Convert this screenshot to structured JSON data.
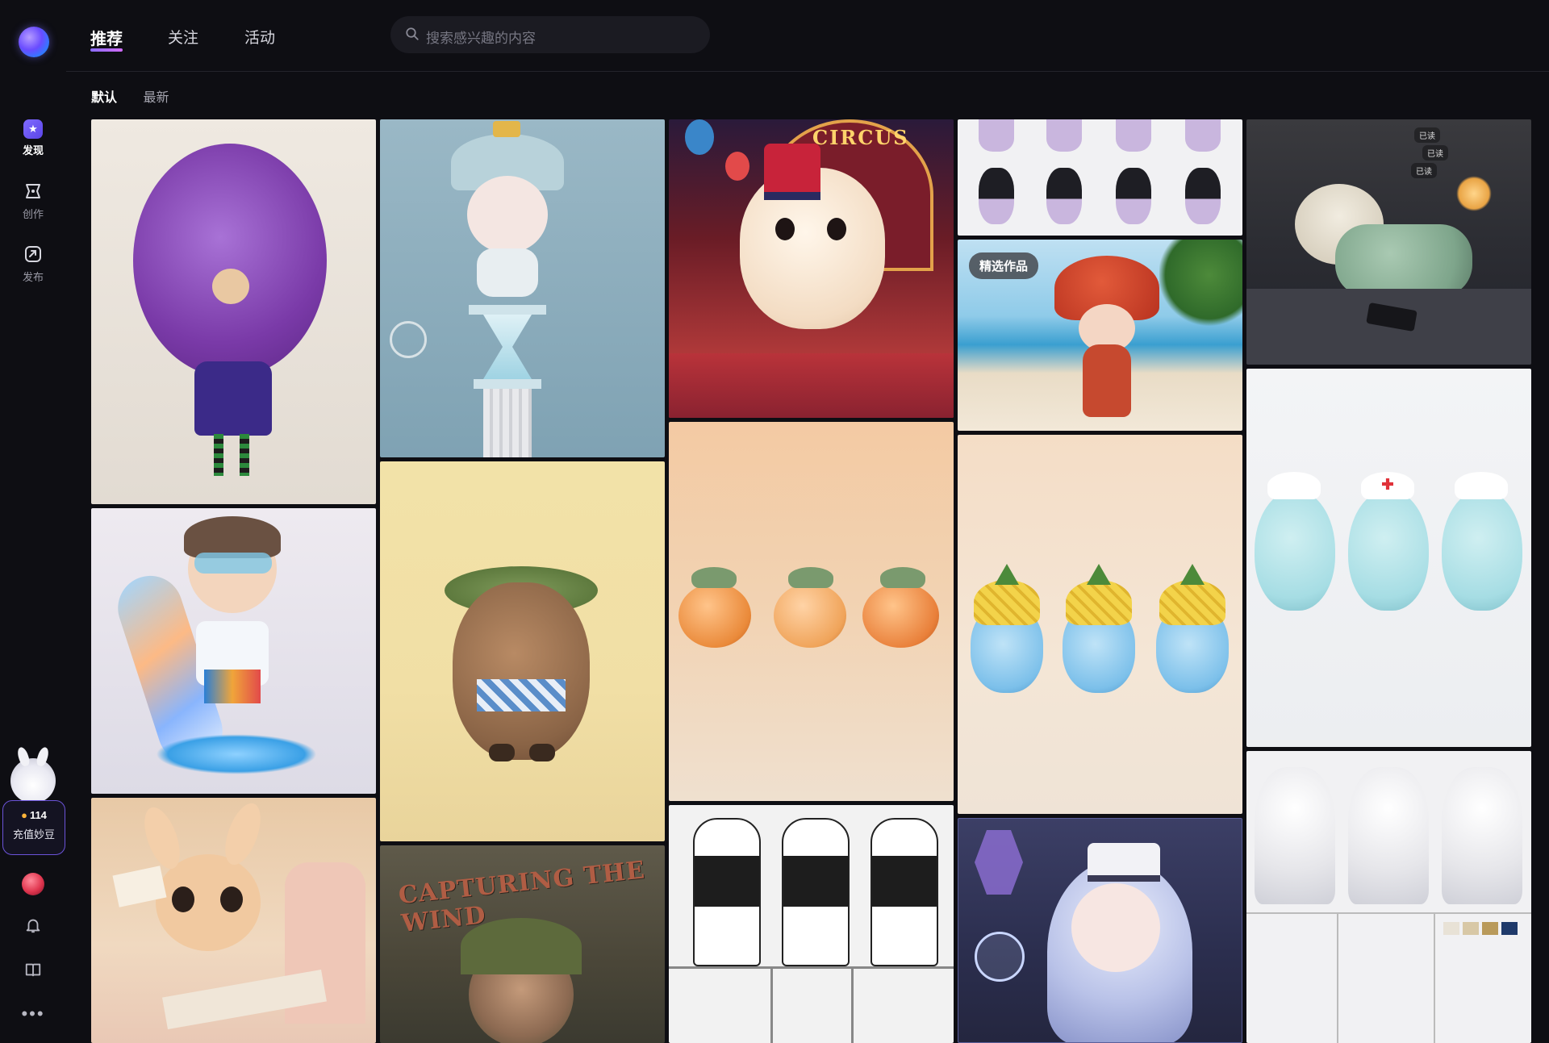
{
  "sidebar": {
    "items": [
      {
        "label": "发现",
        "icon": "discover-icon",
        "active": true
      },
      {
        "label": "创作",
        "icon": "create-icon",
        "active": false
      },
      {
        "label": "发布",
        "icon": "publish-icon",
        "active": false
      }
    ],
    "beans": {
      "count": "114",
      "label": "充值妙豆"
    }
  },
  "header": {
    "tabs": [
      {
        "label": "推荐",
        "active": true
      },
      {
        "label": "关注",
        "active": false
      },
      {
        "label": "活动",
        "active": false
      }
    ],
    "search": {
      "placeholder": "搜索感兴趣的内容"
    }
  },
  "sort_tabs": [
    {
      "label": "默认",
      "active": true
    },
    {
      "label": "最新",
      "active": false
    }
  ],
  "gallery": {
    "featured_badge": "精选作品",
    "card_text": {
      "circus_sign": "CIRCUS",
      "capture_title": "CAPTURING THE WIND",
      "read_tags": [
        "已读",
        "已读",
        "已读"
      ]
    }
  },
  "colors": {
    "background": "#0e0e13",
    "accent": "#8a6dff",
    "bean_border": "#6b53d9"
  }
}
